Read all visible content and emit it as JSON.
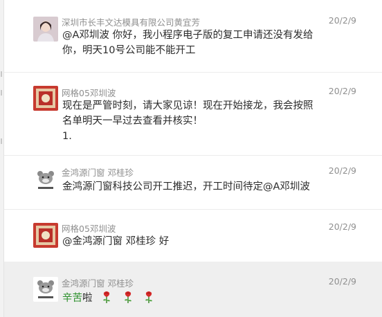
{
  "messages": [
    {
      "sender": "深圳市长丰文达模具有限公司黄宜芳",
      "time": "20/2/9",
      "lines": [
        "@A邓圳波 你好，我小程序电子版的复工申请还没有发给",
        "你，明天10号公司能不能开工"
      ]
    },
    {
      "sender": "网格05邓圳波",
      "time": "20/2/9",
      "lines": [
        "现在是严管时刻，请大家见谅！现在开始接龙，我会按照",
        "名单明天一早过去查看并核实！",
        "1."
      ]
    },
    {
      "sender": "金鸿源门窗 邓桂珍",
      "time": "20/2/9",
      "lines": [
        "金鸿源门窗科技公司开工推迟，开工时间待定@A邓圳波"
      ]
    },
    {
      "sender": "网格05邓圳波",
      "time": "20/2/9",
      "lines": [
        "@金鸿源门窗 邓桂珍 好"
      ]
    },
    {
      "sender": "金鸿源门窗 邓桂珍",
      "time": "20/2/9",
      "highlight_word": "辛苦",
      "rest": "啦"
    }
  ],
  "colors": {
    "text": "#2b2b2b",
    "meta": "#8f8f8f",
    "highlight_bg": "#efefef",
    "green": "#2a8f2a"
  }
}
